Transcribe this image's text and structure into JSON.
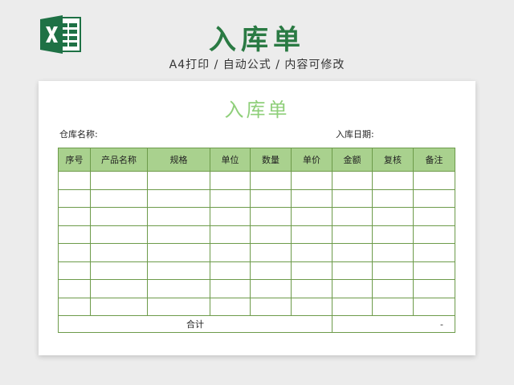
{
  "header": {
    "title": "入库单",
    "subtitle": "A4打印 / 自动公式 / 内容可修改"
  },
  "form": {
    "title": "入库单",
    "warehouse_label": "仓库名称:",
    "date_label": "入库日期:"
  },
  "table": {
    "columns": [
      "序号",
      "产品名称",
      "规格",
      "单位",
      "数量",
      "单价",
      "金额",
      "复核",
      "备注"
    ],
    "empty_rows": 8,
    "total_label": "合计",
    "total_value": "-"
  },
  "colors": {
    "accent": "#2a7a43",
    "header_fill": "#a9d18e",
    "border": "#6d9b4a",
    "form_title": "#8fcf7a"
  },
  "icons": {
    "logo": "excel-icon"
  }
}
